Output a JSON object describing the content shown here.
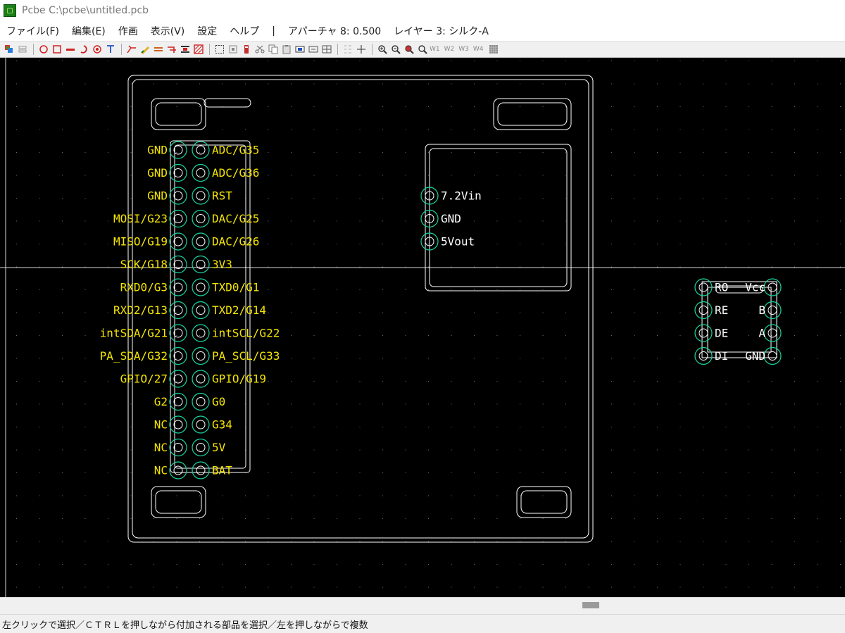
{
  "window": {
    "title": "Pcbe C:\\pcbe\\untitled.pcb"
  },
  "menu": {
    "items": [
      "ファイル(F)",
      "編集(E)",
      "作画",
      "表示(V)",
      "設定",
      "ヘルプ",
      "|",
      "アパーチャ 8: 0.500",
      "レイヤー 3: シルク-A"
    ]
  },
  "toolbar": {
    "icons": [
      "layers-icon",
      "stack-icon",
      "circle-tool-icon",
      "rect-tool-icon",
      "line-tool-icon",
      "arc-tool-icon",
      "target-tool-icon",
      "text-tool-icon",
      "route-icon",
      "pen-icon",
      "bus-icon",
      "pad-icon",
      "via-icon",
      "fill-icon",
      "select-icon",
      "move-icon",
      "component-icon",
      "cut-icon",
      "copy-icon",
      "paste-icon",
      "mirror-icon",
      "rotate-icon",
      "grid-icon",
      "crosshair-icon",
      "zoom-in-icon",
      "zoom-out-icon",
      "zoom-fit-icon",
      "zoom-window-icon"
    ],
    "window_buttons": [
      "W1",
      "W2",
      "W3",
      "W4"
    ]
  },
  "pcb": {
    "colors": {
      "background": "#000000",
      "outline": "#ffffff",
      "pad": "#19d4a0",
      "label": "#f5e600",
      "grid": "#6b6b6b"
    },
    "header_left_labels": [
      "GND",
      "GND",
      "GND",
      "MOSI/G23",
      "MISO/G19",
      "SCK/G18",
      "RXD0/G3",
      "RXD2/G13",
      "intSDA/G21",
      "PA_SDA/G32",
      "GPIO/27",
      "G2",
      "NC",
      "NC",
      "NC"
    ],
    "header_right_labels": [
      "ADC/G35",
      "ADC/G36",
      "RST",
      "DAC/G25",
      "DAC/G26",
      "3V3",
      "TXD0/G1",
      "TXD2/G14",
      "intSCL/G22",
      "PA_SCL/G33",
      "GPIO/G19",
      "G0",
      "G34",
      "5V",
      "BAT"
    ],
    "regulator_labels": [
      "7.2Vin",
      "GND",
      "5Vout"
    ],
    "rs485_left_labels": [
      "RO",
      "RE",
      "DE",
      "DI"
    ],
    "rs485_right_labels": [
      "Vcc",
      "B",
      "A",
      "GND"
    ]
  },
  "status": {
    "text": "左クリックで選択／ＣＴＲＬを押しながら付加される部品を選択／左を押しながらで複数"
  }
}
